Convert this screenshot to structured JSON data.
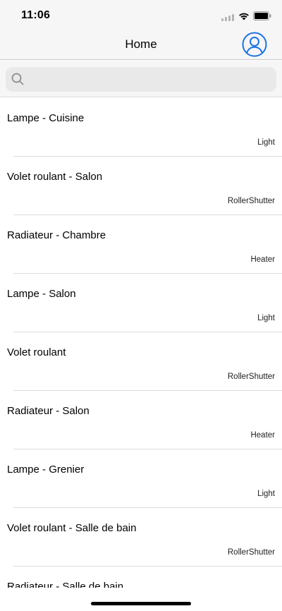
{
  "status_bar": {
    "time": "11:06",
    "icons": [
      "signal-icon",
      "wifi-icon",
      "battery-icon"
    ]
  },
  "nav": {
    "title": "Home",
    "profile_icon": "person-circle-icon",
    "accent_color": "#1a73e8"
  },
  "search": {
    "placeholder": "",
    "value": "",
    "icon": "search-icon"
  },
  "devices": [
    {
      "name": "Lampe - Cuisine",
      "type": "Light"
    },
    {
      "name": "Volet roulant - Salon",
      "type": "RollerShutter"
    },
    {
      "name": "Radiateur - Chambre",
      "type": "Heater"
    },
    {
      "name": "Lampe - Salon",
      "type": "Light"
    },
    {
      "name": "Volet roulant",
      "type": "RollerShutter"
    },
    {
      "name": "Radiateur - Salon",
      "type": "Heater"
    },
    {
      "name": "Lampe - Grenier",
      "type": "Light"
    },
    {
      "name": "Volet roulant - Salle de bain",
      "type": "RollerShutter"
    },
    {
      "name": "Radiateur - Salle de bain",
      "type": ""
    }
  ]
}
